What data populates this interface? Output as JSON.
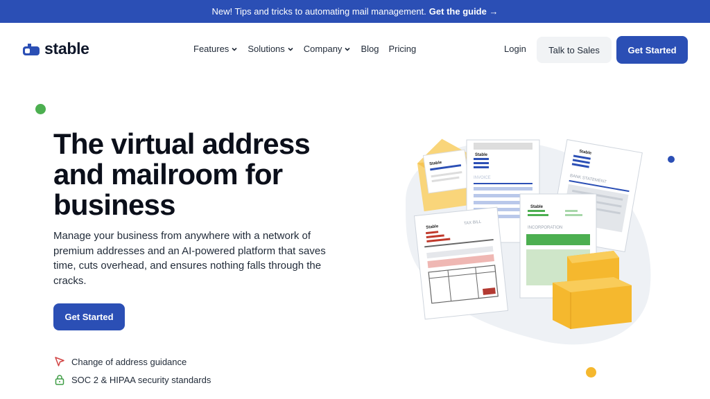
{
  "announcement": {
    "text": "New! Tips and tricks to automating mail management.",
    "cta": "Get the guide →"
  },
  "nav": {
    "logo": "stable",
    "menu": [
      {
        "label": "Features",
        "dropdown": true
      },
      {
        "label": "Solutions",
        "dropdown": true
      },
      {
        "label": "Company",
        "dropdown": true
      },
      {
        "label": "Blog",
        "dropdown": false
      },
      {
        "label": "Pricing",
        "dropdown": false
      }
    ],
    "login": "Login",
    "talk_to_sales": "Talk to Sales",
    "get_started": "Get Started"
  },
  "hero": {
    "headline": "The virtual address and mailroom for business",
    "subtext": "Manage your business from anywhere with a network of premium addresses and an AI-powered platform that saves time, cuts overhead, and ensures nothing falls through the cracks.",
    "cta": "Get Started",
    "features": [
      {
        "icon": "cursor-arrow-icon",
        "label": "Change of address guidance"
      },
      {
        "icon": "lock-icon",
        "label": "SOC 2 & HIPAA security standards"
      }
    ]
  },
  "illustration": {
    "doc_brand": "Stable",
    "invoice_label": "INVOICE",
    "bank_label": "BANK STATEMENT",
    "tax_label": "TAX BILL",
    "incorporation_label": "INCORPORATION"
  },
  "colors": {
    "brand": "#2b4fb5",
    "green": "#4caf50",
    "red": "#c0392b",
    "box": "#f5b82e"
  }
}
